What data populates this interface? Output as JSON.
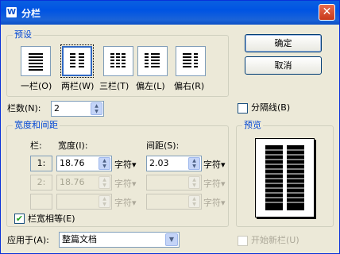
{
  "window": {
    "title": "分栏",
    "icon_letter": "W",
    "close_glyph": "✕"
  },
  "presets": {
    "group_label": "预设",
    "items": [
      {
        "label": "一栏(O)",
        "icon": "one-column-icon"
      },
      {
        "label": "两栏(W)",
        "icon": "two-column-icon",
        "selected": true
      },
      {
        "label": "三栏(T)",
        "icon": "three-column-icon"
      },
      {
        "label": "偏左(L)",
        "icon": "left-column-icon"
      },
      {
        "label": "偏右(R)",
        "icon": "right-column-icon"
      }
    ]
  },
  "buttons": {
    "ok": "确定",
    "cancel": "取消"
  },
  "columns": {
    "label": "栏数(N):",
    "value": "2"
  },
  "divider": {
    "label": "分隔线(B)",
    "checked": false
  },
  "width_spacing": {
    "group_label": "宽度和间距",
    "col_header": "栏:",
    "width_header": "宽度(I):",
    "spacing_header": "间距(S):",
    "rows": [
      {
        "index": "1:",
        "width": "18.76",
        "width_unit": "字符▾",
        "spacing": "2.03",
        "spacing_unit": "字符▾",
        "enabled": true
      },
      {
        "index": "2:",
        "width": "18.76",
        "width_unit": "字符▾",
        "spacing": "",
        "spacing_unit": "字符▾",
        "enabled": false
      },
      {
        "index": "",
        "width": "",
        "width_unit": "字符▾",
        "spacing": "",
        "spacing_unit": "字符▾",
        "enabled": false
      }
    ],
    "equal_width": {
      "label": "栏宽相等(E)",
      "checked": true,
      "check_glyph": "✔"
    }
  },
  "preview": {
    "group_label": "预览"
  },
  "apply_to": {
    "label": "应用于(A):",
    "value": "整篇文档",
    "arrow": "▼"
  },
  "new_column": {
    "label": "开始新栏(U)",
    "checked": false
  },
  "colors": {
    "accent": "#0046d5",
    "titlebar": "#0054e3",
    "check": "#21a121"
  }
}
